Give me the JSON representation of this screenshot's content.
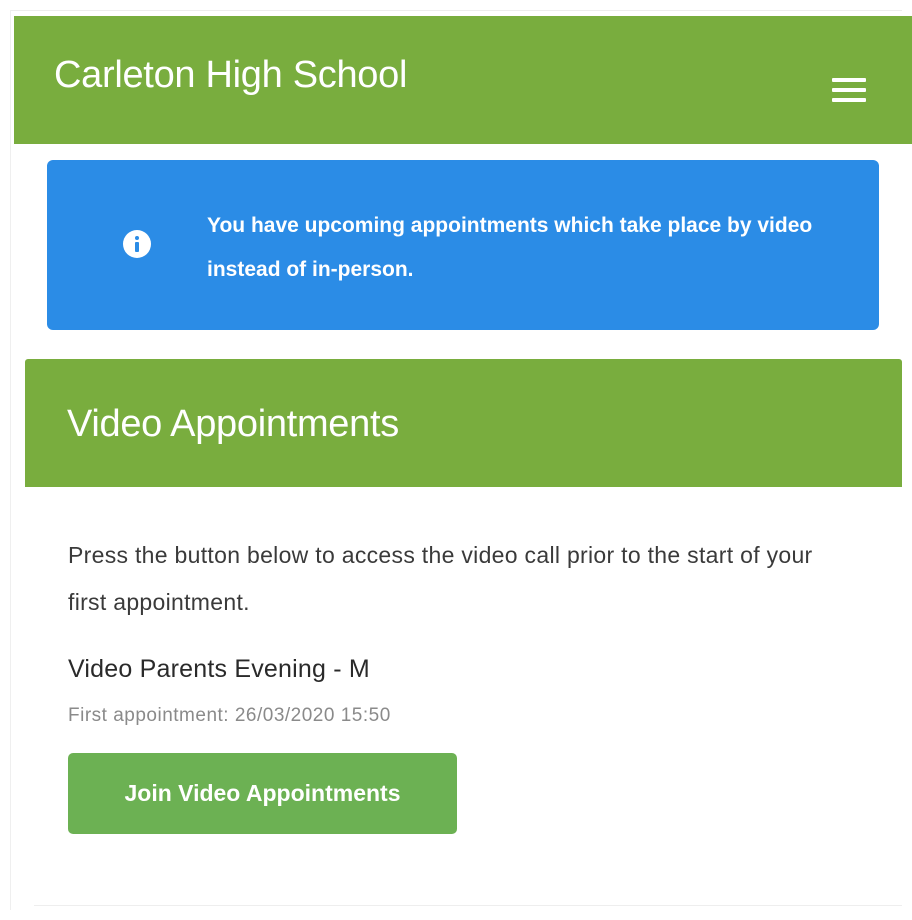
{
  "header": {
    "title": "Carleton High School",
    "menu_icon": "hamburger-menu-icon"
  },
  "alert": {
    "icon": "info-icon",
    "message": "You have upcoming appointments which take place by video instead of in-person.",
    "color": "#2b8ce6"
  },
  "panel": {
    "heading": "Video Appointments",
    "description": "Press the button below to access the video call prior to the start of your first appointment.",
    "event_title": "Video Parents Evening - M",
    "first_appointment": "First appointment: 26/03/2020 15:50",
    "join_button_label": "Join Video Appointments"
  },
  "colors": {
    "brand_green": "#79ad3e",
    "button_green": "#6cb153",
    "alert_blue": "#2b8ce6"
  }
}
